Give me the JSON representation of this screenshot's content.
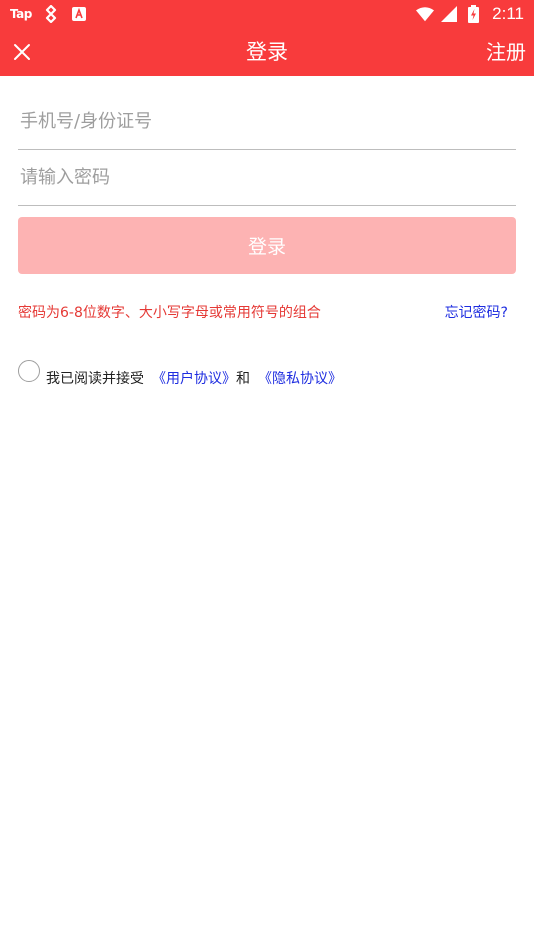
{
  "status_bar": {
    "app_badge": "Tap",
    "time": "2:11"
  },
  "app_bar": {
    "title": "登录",
    "register_label": "注册"
  },
  "form": {
    "phone_placeholder": "手机号/身份证号",
    "phone_value": "",
    "password_placeholder": "请输入密码",
    "password_value": "",
    "login_label": "登录"
  },
  "hint": {
    "password_rule": "密码为6-8位数字、大小写字母或常用符号的组合",
    "forgot_label": "忘记密码?"
  },
  "agreement": {
    "prefix": "我已阅读并接受",
    "user_agreement": "《用户协议》",
    "conjunction": "和",
    "privacy_agreement": "《隐私协议》",
    "checked": false
  },
  "colors": {
    "brand": "#f83b3c",
    "button_disabled": "#fdb3b3",
    "hint_red": "#e53935",
    "link_blue": "#1e2de0"
  },
  "icons": {
    "close": "close-icon",
    "status": [
      "game-app-icon",
      "autocorrect-app-icon",
      "wifi-icon",
      "cellular-signal-icon",
      "battery-charging-icon"
    ]
  }
}
